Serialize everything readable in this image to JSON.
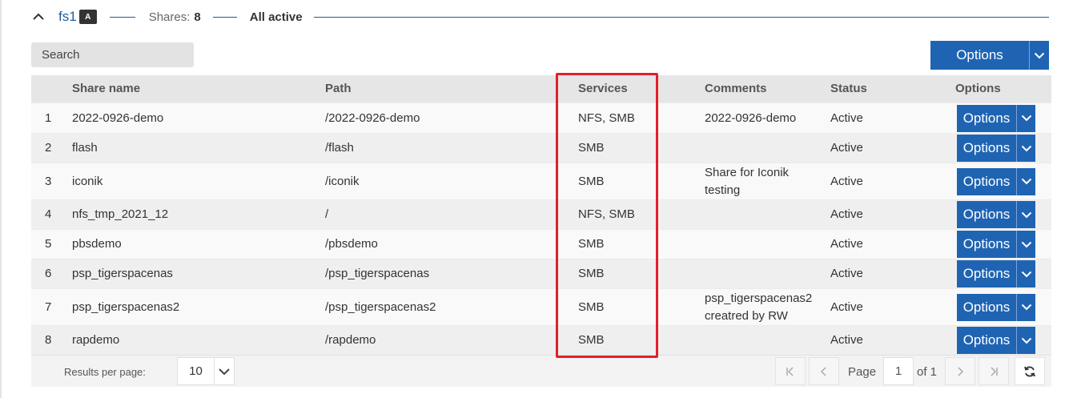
{
  "header": {
    "fs_name": "fs1",
    "fs_badge": "A",
    "shares_label": "Shares:",
    "shares_count": "8",
    "status_summary": "All active"
  },
  "toolbar": {
    "search_placeholder": "Search",
    "options_label": "Options"
  },
  "table": {
    "columns": [
      "Share name",
      "Path",
      "Services",
      "Comments",
      "Status",
      "Options"
    ],
    "rows": [
      {
        "index": "1",
        "name": "2022-0926-demo",
        "path": "/2022-0926-demo",
        "services": "NFS, SMB",
        "comment": "2022-0926-demo",
        "status": "Active",
        "options": "Options"
      },
      {
        "index": "2",
        "name": "flash",
        "path": "/flash",
        "services": "SMB",
        "comment": "",
        "status": "Active",
        "options": "Options"
      },
      {
        "index": "3",
        "name": "iconik",
        "path": "/iconik",
        "services": "SMB",
        "comment": "Share for Iconik testing",
        "status": "Active",
        "options": "Options"
      },
      {
        "index": "4",
        "name": "nfs_tmp_2021_12",
        "path": "/",
        "services": "NFS, SMB",
        "comment": "",
        "status": "Active",
        "options": "Options"
      },
      {
        "index": "5",
        "name": "pbsdemo",
        "path": "/pbsdemo",
        "services": "SMB",
        "comment": "",
        "status": "Active",
        "options": "Options"
      },
      {
        "index": "6",
        "name": "psp_tigerspacenas",
        "path": "/psp_tigerspacenas",
        "services": "SMB",
        "comment": "",
        "status": "Active",
        "options": "Options"
      },
      {
        "index": "7",
        "name": "psp_tigerspacenas2",
        "path": "/psp_tigerspacenas2",
        "services": "SMB",
        "comment": "psp_tigerspacenas2 creatred by RW",
        "status": "Active",
        "options": "Options"
      },
      {
        "index": "8",
        "name": "rapdemo",
        "path": "/rapdemo",
        "services": "SMB",
        "comment": "",
        "status": "Active",
        "options": "Options"
      }
    ]
  },
  "pagination": {
    "results_per_page_label": "Results per page:",
    "results_per_page": "10",
    "page_label": "Page",
    "current_page": "1",
    "of_label": "of 1"
  },
  "icons": {
    "collapse": "chevron-up-icon",
    "dropdown": "chevron-down-icon",
    "first": "first-page-icon",
    "prev": "prev-page-icon",
    "next": "next-page-icon",
    "last": "last-page-icon",
    "refresh": "refresh-icon"
  },
  "colors": {
    "accent": "#1f64b3",
    "link": "#1d5f9e",
    "highlight": "#e0202a"
  }
}
